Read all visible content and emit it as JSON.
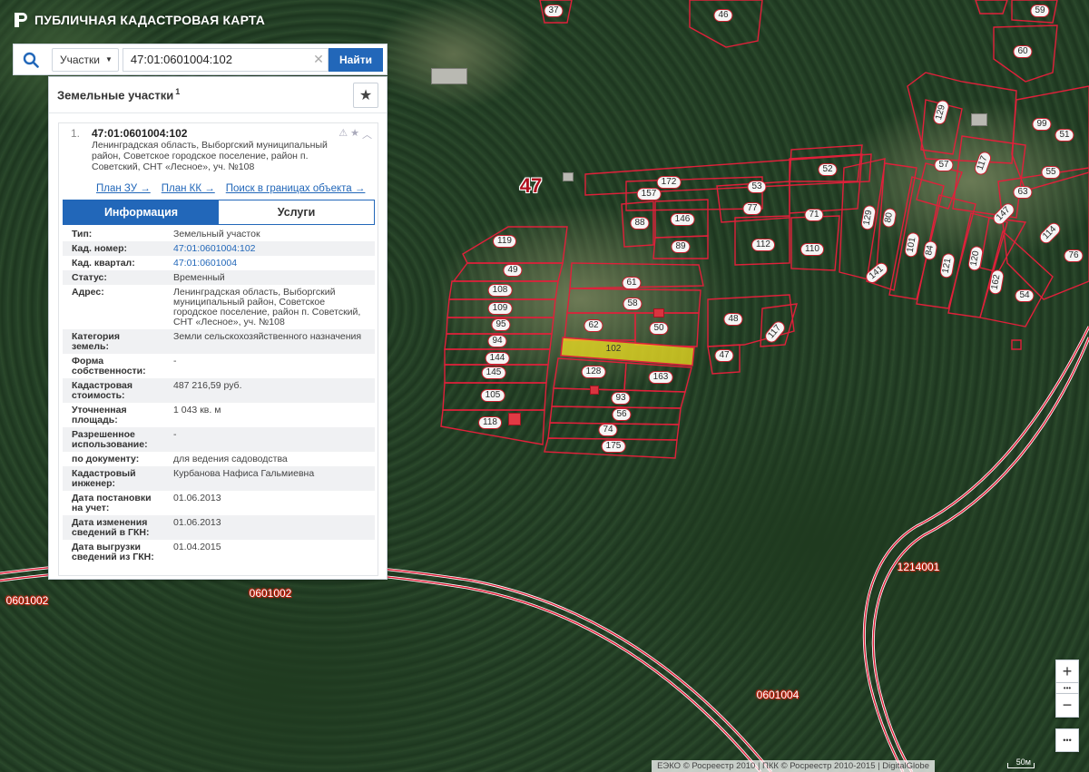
{
  "app": {
    "title": "ПУБЛИЧНАЯ КАДАСТРОВАЯ КАРТА"
  },
  "search": {
    "type_label": "Участки",
    "query": "47:01:0601004:102",
    "find_label": "Найти"
  },
  "panel": {
    "title": "Земельные участки",
    "count": "1"
  },
  "result": {
    "index": "1.",
    "cad_number": "47:01:0601004:102",
    "address": "Ленинградская область, Выборгский муниципальный район, Советское городское поселение, район п. Советский, СНТ «Лесное», уч. №108",
    "links": [
      "План ЗУ →",
      "План КК →",
      "Поиск в границах объекта →"
    ],
    "tabs": [
      "Информация",
      "Услуги"
    ],
    "info": [
      {
        "k": "Тип:",
        "v": "Земельный участок"
      },
      {
        "k": "Кад. номер:",
        "v": "47:01:0601004:102"
      },
      {
        "k": "Кад. квартал:",
        "v": "47:01:0601004"
      },
      {
        "k": "Статус:",
        "v": "Временный"
      },
      {
        "k": "Адрес:",
        "v": "Ленинградская область, Выборгский муниципальный район, Советское городское поселение, район п. Советский, СНТ «Лесное», уч. №108"
      },
      {
        "k": "Категория земель:",
        "v": "Земли сельскохозяйственного назначения"
      },
      {
        "k": "Форма собственности:",
        "v": "-"
      },
      {
        "k": "Кадастровая стоимость:",
        "v": "487 216,59 руб."
      },
      {
        "k": "Уточненная площадь:",
        "v": "1 043 кв. м"
      },
      {
        "k": "Разрешенное использование:",
        "v": "-"
      },
      {
        "k": "по документу:",
        "v": "для ведения садоводства"
      },
      {
        "k": "Кадастровый инженер:",
        "v": "Курбанова Нафиса Гальмиевна"
      },
      {
        "k": "Дата постановки на учет:",
        "v": "01.06.2013"
      },
      {
        "k": "Дата изменения сведений в ГКН:",
        "v": "01.06.2013"
      },
      {
        "k": "Дата выгрузки сведений из ГКН:",
        "v": "01.04.2015"
      }
    ]
  },
  "map": {
    "district_label": "47",
    "quarters": [
      "0601002",
      "0601002",
      "0601004",
      "1214001"
    ],
    "plots": [
      "37",
      "46",
      "59",
      "60",
      "129",
      "57",
      "117",
      "99",
      "51",
      "55",
      "63",
      "147",
      "114",
      "76",
      "52",
      "172",
      "157",
      "53",
      "77",
      "71",
      "88",
      "146",
      "89",
      "112",
      "110",
      "129",
      "80",
      "101",
      "84",
      "121",
      "120",
      "162",
      "54",
      "141",
      "119",
      "49",
      "108",
      "109",
      "95",
      "94",
      "144",
      "145",
      "105",
      "118",
      "61",
      "58",
      "62",
      "50",
      "102",
      "128",
      "163",
      "93",
      "56",
      "74",
      "175",
      "48",
      "117",
      "47"
    ],
    "attribution": "ЕЭКО © Росреестр 2010 | ПКК © Росреестр 2010-2015 | DigitalGlobe",
    "scale_label": "50м"
  },
  "controls": {
    "zoom_in": "+",
    "zoom_out": "−",
    "more": "•••"
  },
  "colors": {
    "accent": "#2267b9",
    "plot_border": "#e0203a",
    "highlight": "#f0e020"
  }
}
